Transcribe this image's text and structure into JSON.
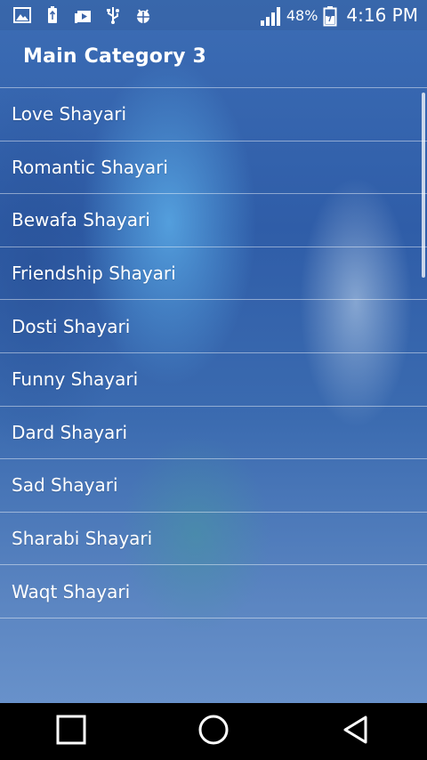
{
  "status_bar": {
    "battery_percent": "48%",
    "time": "4:16 PM",
    "left_icons": [
      "image-icon",
      "usb-battery-icon",
      "media-icon",
      "usb-icon",
      "android-debug-icon"
    ]
  },
  "action_bar": {
    "title": "Main Category 3"
  },
  "list": {
    "items": [
      {
        "label": "Love Shayari"
      },
      {
        "label": "Romantic Shayari"
      },
      {
        "label": "Bewafa Shayari"
      },
      {
        "label": "Friendship Shayari"
      },
      {
        "label": "Dosti Shayari"
      },
      {
        "label": "Funny Shayari"
      },
      {
        "label": "Dard Shayari"
      },
      {
        "label": "Sad Shayari"
      },
      {
        "label": "Sharabi Shayari"
      },
      {
        "label": "Waqt Shayari"
      }
    ]
  },
  "nav_bar": {
    "buttons": [
      "recent-apps-icon",
      "home-icon",
      "back-icon"
    ]
  },
  "colors": {
    "text": "#ffffff",
    "background_primary": "#3c6db5",
    "nav_bar": "#000000"
  }
}
